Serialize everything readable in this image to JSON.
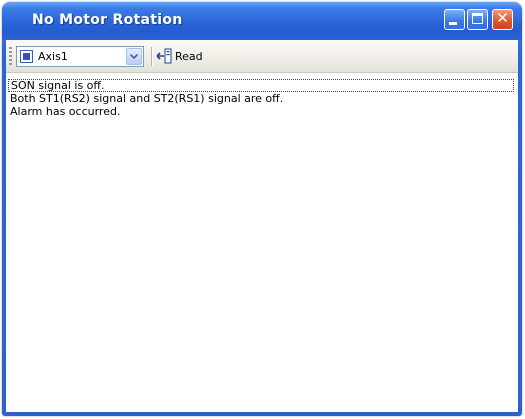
{
  "window": {
    "title": "No Motor Rotation",
    "controls": {
      "minimize_icon": "minimize-icon",
      "maximize_icon": "maximize-icon",
      "close_icon": "close-icon",
      "close_glyph": "✕"
    },
    "colors": {
      "titlebar": "#2a64d8",
      "close_button": "#d8572f"
    }
  },
  "toolbar": {
    "axis_select": {
      "icon": "axis-icon",
      "value": "Axis1"
    },
    "read_button": {
      "icon": "read-icon",
      "label": "Read"
    }
  },
  "messages": [
    "SON signal is off.",
    "Both ST1(RS2) signal and ST2(RS1) signal are off.",
    "Alarm has occurred."
  ]
}
